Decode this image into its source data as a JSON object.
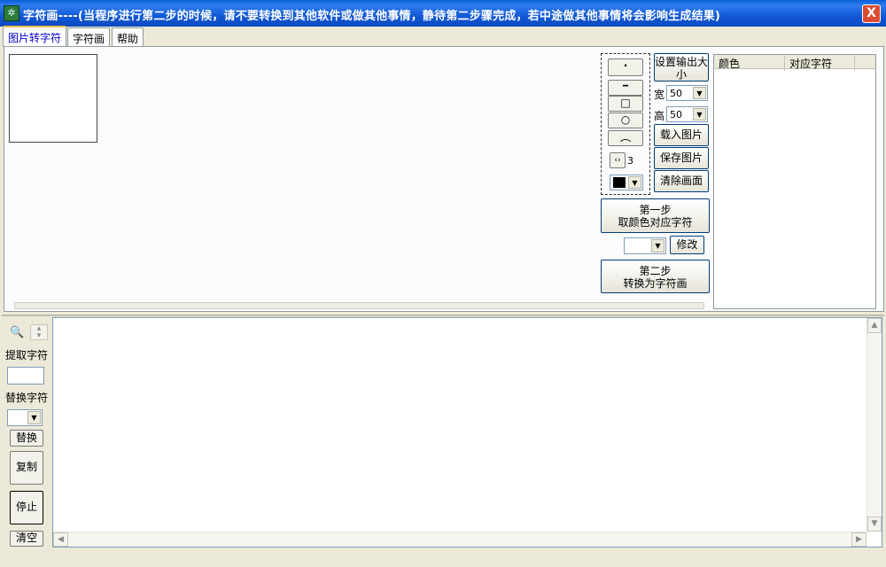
{
  "window": {
    "title": "字符画----(当程序进行第二步的时候，请不要转换到其他软件或做其他事情，静待第二步骤完成，若中途做其他事情将会影响生成结果)",
    "close_label": "X"
  },
  "tabs": [
    {
      "label": "图片转字符",
      "active": true
    },
    {
      "label": "字符画",
      "active": false
    },
    {
      "label": "帮助",
      "active": false
    }
  ],
  "tools": {
    "dot_label": "·",
    "line_label": "━",
    "rect_label": "□",
    "circle_label": "○",
    "arc_label": "︵",
    "pen_size": "3",
    "color": "#000000"
  },
  "output": {
    "set_size_label": "设置输出大小",
    "width_label": "宽",
    "width_value": "50",
    "height_label": "高",
    "height_value": "50"
  },
  "actions": {
    "load_label": "载入图片",
    "save_label": "保存图片",
    "clear_canvas_label": "清除画面",
    "step1_line1": "第一步",
    "step1_line2": "取颜色对应字符",
    "modify_label": "修改",
    "step2_line1": "第二步",
    "step2_line2": "转换为字符画"
  },
  "color_table": {
    "columns": [
      "颜色",
      "对应字符"
    ]
  },
  "side": {
    "extract_label": "提取字符",
    "replace_char_label": "替换字符",
    "replace_button": "替换",
    "copy_button": "复制",
    "stop_button": "停止",
    "clear_button": "清空"
  }
}
